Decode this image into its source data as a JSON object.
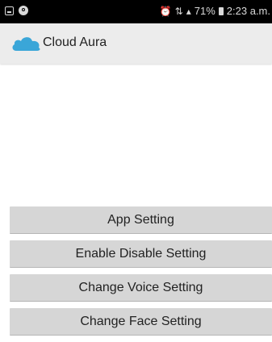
{
  "status_bar": {
    "signal_text": "71%",
    "time": "2:23 a.m."
  },
  "app_bar": {
    "title": "Cloud Aura",
    "icon": "cloud-icon",
    "accent_color": "#3aa6d8"
  },
  "settings": {
    "buttons": [
      {
        "label": "App Setting"
      },
      {
        "label": "Enable Disable Setting"
      },
      {
        "label": "Change Voice Setting"
      },
      {
        "label": "Change Face Setting"
      }
    ]
  }
}
